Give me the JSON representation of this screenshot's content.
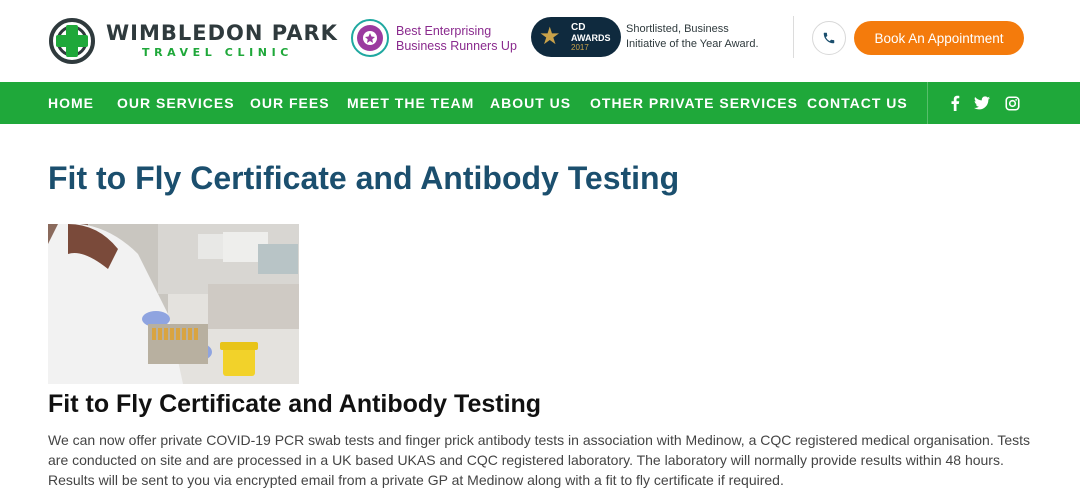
{
  "header": {
    "logo_title": "WIMBLEDON PARK",
    "logo_subtitle": "TRAVEL CLINIC",
    "award1_line1": "Best Enterprising",
    "award1_line2": "Business Runners Up",
    "award2_badge_l1": "CD",
    "award2_badge_l2": "AWARDS",
    "award2_badge_l3": "2017",
    "award2_line1": "Shortlisted, Business",
    "award2_line2": "Initiative of the Year Award.",
    "book_label": "Book An Appointment",
    "phone_icon": "phone-icon"
  },
  "nav": {
    "items": [
      "HOME",
      "OUR SERVICES",
      "OUR FEES",
      "MEET THE TEAM",
      "ABOUT US",
      "OTHER PRIVATE SERVICES",
      "CONTACT US"
    ],
    "social_icons": [
      "facebook-icon",
      "twitter-icon",
      "instagram-icon"
    ]
  },
  "main": {
    "page_title": "Fit to Fly Certificate and Antibody Testing",
    "section_heading": "Fit to Fly Certificate and Antibody Testing",
    "body": "We can now offer private COVID-19 PCR swab tests and finger prick antibody tests in association with Medinow, a CQC registered medical organisation. Tests are conducted on site and are processed in a UK based UKAS and CQC registered laboratory. The laboratory will normally provide results within 48 hours. Results will be sent to you via encrypted email from a private GP at Medinow along with a fit to fly certificate if required."
  },
  "colors": {
    "brand_green": "#1fa83a",
    "accent_orange": "#f47b0c",
    "title_blue": "#1b4f6e"
  }
}
